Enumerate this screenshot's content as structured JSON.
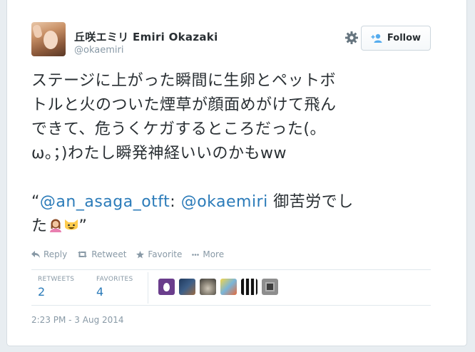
{
  "user": {
    "name": "丘咲エミリ Emiri Okazaki",
    "handle": "@okaemiri"
  },
  "follow_label": "Follow",
  "tweet": {
    "line1": "ステージに上がった瞬間に生卵とペットボ",
    "line2": "トルと火のついた煙草が顔面めがけて飛ん",
    "line3": "できて、危うくケガするところだった(。",
    "line4": "ω。；)わたし瞬発神経いいのかもww",
    "quote_open": "“",
    "mention1": "@an_asaga_otft",
    "colon": ": ",
    "mention2": "@okaemiri",
    "text_after": " 御苦労でし",
    "line6_start": "た",
    "quote_close": "”"
  },
  "actions": {
    "reply": "Reply",
    "retweet": "Retweet",
    "favorite": "Favorite",
    "more": "More"
  },
  "stats": {
    "retweets_label": "RETWEETS",
    "retweets_value": "2",
    "favorites_label": "FAVORITES",
    "favorites_value": "4"
  },
  "timestamp": "2:23 PM - 3 Aug 2014",
  "colors": {
    "link": "#2b7bb9",
    "text": "#292f33",
    "muted": "#8899a6"
  }
}
